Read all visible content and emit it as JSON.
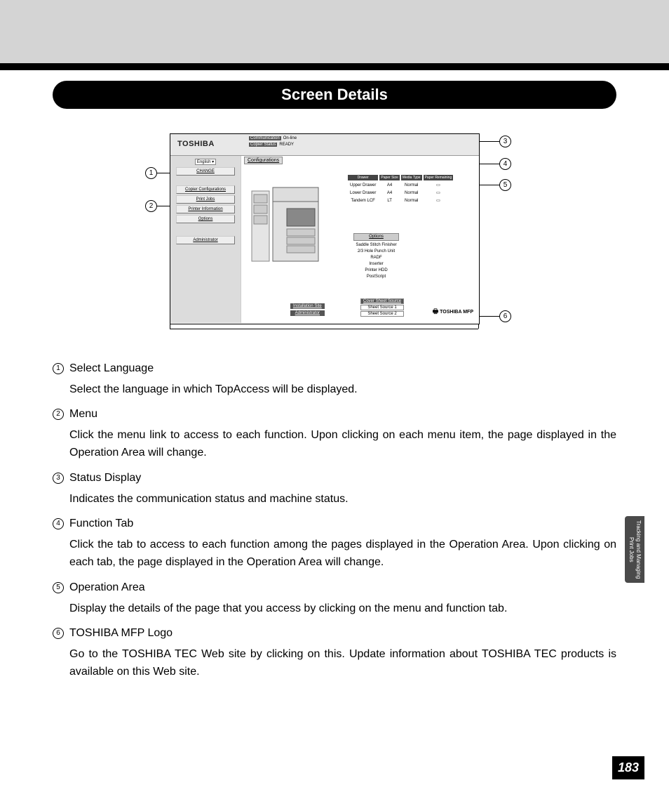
{
  "page": {
    "title": "Screen Details",
    "number": "183",
    "side_tab": "Tracking and\nManaging Print Jobs"
  },
  "screenshot": {
    "brand": "TOSHIBA",
    "status": {
      "comm_label": "Communication",
      "comm_value": "On-line",
      "copier_label": "Copier Status",
      "copier_value": "READY"
    },
    "lang_select": "English",
    "change_btn": "CHANGE",
    "sidebar": [
      "Copier Configurations",
      "Print Jobs",
      "Printer Information",
      "Options",
      "Administrator"
    ],
    "tab": "Configurations",
    "drawer_headers": [
      "Drawer",
      "Paper Size",
      "Media Type",
      "Paper Remaining"
    ],
    "drawers": [
      {
        "name": "Upper Drawer",
        "size": "A4",
        "type": "Normal"
      },
      {
        "name": "Lower Drawer",
        "size": "A4",
        "type": "Normal"
      },
      {
        "name": "Tandem LCF",
        "size": "LT",
        "type": "Normal"
      }
    ],
    "options_header": "Options",
    "options_list": [
      "Saddle Stitch Finisher",
      "2/3 Hole Punch Unit",
      "RADF",
      "Inserter",
      "Printer HDD",
      "PostScript"
    ],
    "lower_buttons": [
      "Installation Site",
      "Administrator"
    ],
    "sheet_buttons": [
      "Cover Sheet Source",
      "Sheet Source 1",
      "Sheet Source 2"
    ],
    "mfp_logo": "TOSHIBA MFP"
  },
  "callouts": {
    "c1": "1",
    "c2": "2",
    "c3": "3",
    "c4": "4",
    "c5": "5",
    "c6": "6"
  },
  "descriptions": [
    {
      "num": "1",
      "title": "Select Language",
      "text": "Select the language in which TopAccess will be displayed."
    },
    {
      "num": "2",
      "title": "Menu",
      "text": "Click the menu link to access to each function.  Upon clicking on each menu item, the page displayed in the Operation Area will change."
    },
    {
      "num": "3",
      "title": "Status Display",
      "text": "Indicates the communication status and machine status."
    },
    {
      "num": "4",
      "title": "Function Tab",
      "text": "Click the tab to access to each function among the pages displayed in the Operation Area.  Upon clicking on each tab, the page displayed in the Operation Area will change."
    },
    {
      "num": "5",
      "title": "Operation Area",
      "text": "Display the details of the page that you access by clicking on the menu and function tab."
    },
    {
      "num": "6",
      "title": "TOSHIBA MFP Logo",
      "text": "Go to the TOSHIBA TEC Web site by clicking on this.  Update information about TOSHIBA TEC products is available on this Web site."
    }
  ]
}
